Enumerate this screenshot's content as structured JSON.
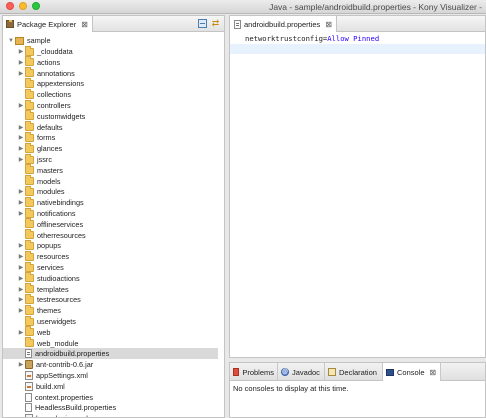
{
  "window": {
    "title": "Java - sample/androidbuild.properties - Kony Visualizer -"
  },
  "explorer": {
    "tab_label": "Package Explorer",
    "close_glyph": "⊠",
    "project": "sample",
    "items": [
      {
        "label": "_clouddata",
        "type": "folder",
        "expandable": true
      },
      {
        "label": "actions",
        "type": "folder",
        "expandable": true
      },
      {
        "label": "annotations",
        "type": "folder",
        "expandable": true
      },
      {
        "label": "appextensions",
        "type": "folder",
        "expandable": false
      },
      {
        "label": "collections",
        "type": "folder",
        "expandable": false
      },
      {
        "label": "controllers",
        "type": "folder",
        "expandable": true
      },
      {
        "label": "customwidgets",
        "type": "folder",
        "expandable": false
      },
      {
        "label": "defaults",
        "type": "folder",
        "expandable": true
      },
      {
        "label": "forms",
        "type": "folder",
        "expandable": true
      },
      {
        "label": "glances",
        "type": "folder",
        "expandable": true
      },
      {
        "label": "jssrc",
        "type": "folder",
        "expandable": true
      },
      {
        "label": "masters",
        "type": "folder",
        "expandable": false
      },
      {
        "label": "models",
        "type": "folder",
        "expandable": false
      },
      {
        "label": "modules",
        "type": "folder",
        "expandable": true
      },
      {
        "label": "nativebindings",
        "type": "folder",
        "expandable": true
      },
      {
        "label": "notifications",
        "type": "folder",
        "expandable": true
      },
      {
        "label": "offlineservices",
        "type": "folder",
        "expandable": false
      },
      {
        "label": "otherresources",
        "type": "folder",
        "expandable": false
      },
      {
        "label": "popups",
        "type": "folder",
        "expandable": true
      },
      {
        "label": "resources",
        "type": "folder",
        "expandable": true
      },
      {
        "label": "services",
        "type": "folder",
        "expandable": true
      },
      {
        "label": "studioactions",
        "type": "folder",
        "expandable": true
      },
      {
        "label": "templates",
        "type": "folder",
        "expandable": true
      },
      {
        "label": "testresources",
        "type": "folder",
        "expandable": true
      },
      {
        "label": "themes",
        "type": "folder",
        "expandable": true
      },
      {
        "label": "userwidgets",
        "type": "folder",
        "expandable": false
      },
      {
        "label": "web",
        "type": "folder",
        "expandable": true
      },
      {
        "label": "web_module",
        "type": "folder",
        "expandable": false
      },
      {
        "label": "androidbuild.properties",
        "type": "props",
        "expandable": false,
        "selected": true
      },
      {
        "label": "ant-contrib-0.6.jar",
        "type": "jar",
        "expandable": true
      },
      {
        "label": "appSettings.xml",
        "type": "xml",
        "expandable": false
      },
      {
        "label": "build.xml",
        "type": "xml",
        "expandable": false
      },
      {
        "label": "context.properties",
        "type": "file",
        "expandable": false
      },
      {
        "label": "HeadlessBuild.properties",
        "type": "file",
        "expandable": false
      },
      {
        "label": "konyplugins.xml",
        "type": "xml",
        "expandable": false
      }
    ]
  },
  "editor": {
    "tab_label": "androidbuild.properties",
    "close_glyph": "⊠",
    "line_key": "networktrustconfig=",
    "line_value": "Allow Pinned"
  },
  "bottom": {
    "tabs": [
      {
        "label": "Problems",
        "icon": "problems-icon"
      },
      {
        "label": "Javadoc",
        "icon": "javadoc-icon"
      },
      {
        "label": "Declaration",
        "icon": "declaration-icon"
      },
      {
        "label": "Console",
        "icon": "console-icon",
        "active": true
      }
    ],
    "close_glyph": "⊠",
    "message": "No consoles to display at this time."
  }
}
